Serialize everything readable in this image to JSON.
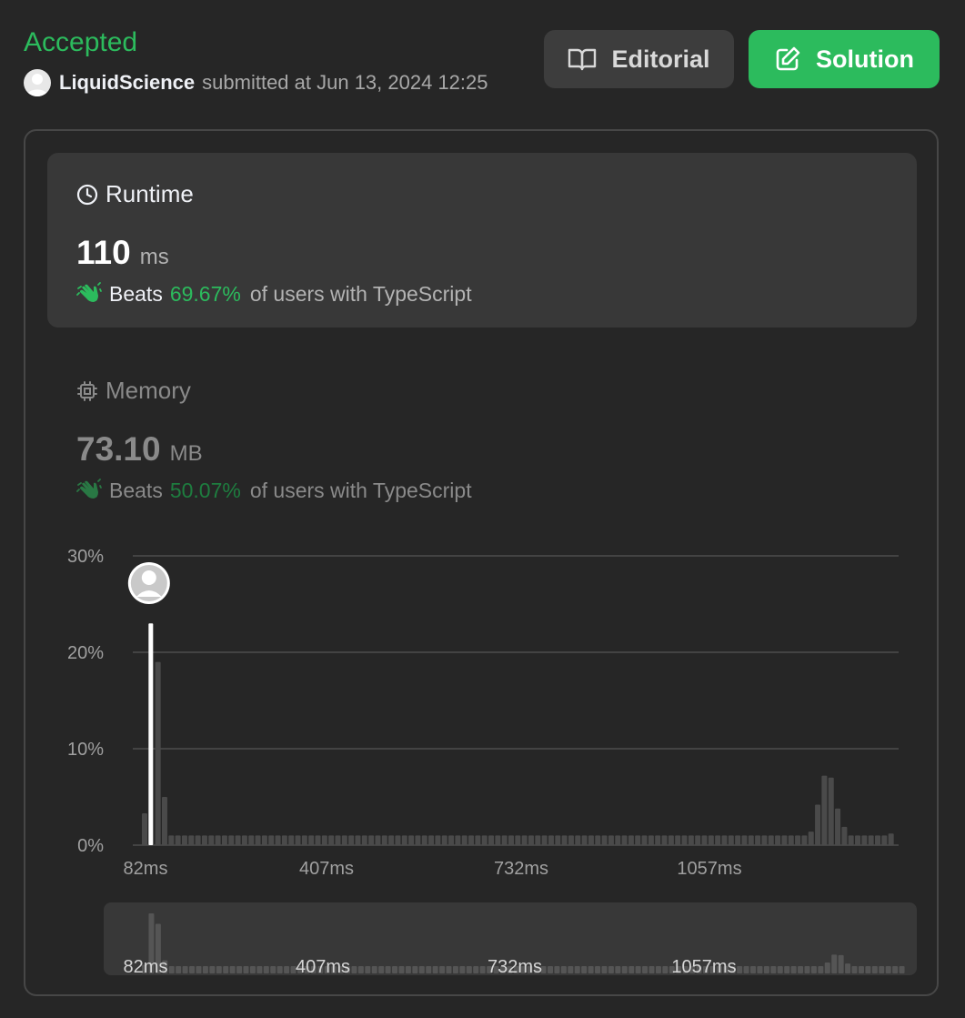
{
  "header": {
    "status": "Accepted",
    "username": "LiquidScience",
    "submitted_text": "submitted at Jun 13, 2024 12:25"
  },
  "buttons": {
    "editorial": "Editorial",
    "solution": "Solution"
  },
  "runtime": {
    "title": "Runtime",
    "value": "110",
    "unit": "ms",
    "beats_label": "Beats",
    "beats_percent": "69.67%",
    "beats_suffix": "of users with TypeScript"
  },
  "memory": {
    "title": "Memory",
    "value": "73.10",
    "unit": "MB",
    "beats_label": "Beats",
    "beats_percent": "50.07%",
    "beats_suffix": "of users with TypeScript"
  },
  "icons": {
    "editorial": "book-icon",
    "solution": "edit-icon",
    "runtime": "clock-icon",
    "memory": "chip-icon",
    "beats": "clapping-hands-icon"
  },
  "colors": {
    "accepted": "#2cbb5d",
    "solution_button": "#2cbb5d",
    "beats_percent": "#2cbb5d",
    "bar": "#4a4a4a",
    "user_bar": "#ffffff"
  },
  "chart_data": {
    "type": "bar",
    "x_ticks": [
      "82ms",
      "407ms",
      "732ms",
      "1057ms"
    ],
    "y_ticks": [
      "0%",
      "10%",
      "20%",
      "30%"
    ],
    "ylim": [
      0,
      30
    ],
    "grid": true,
    "values": [
      3.3,
      23,
      19,
      5,
      1,
      1,
      1,
      1,
      1,
      1,
      1,
      1,
      1,
      1,
      1,
      1,
      1,
      1,
      1,
      1,
      1,
      1,
      1,
      1,
      1,
      1,
      1,
      1,
      1,
      1,
      1,
      1,
      1,
      1,
      1,
      1,
      1,
      1,
      1,
      1,
      1,
      1,
      1,
      1,
      1,
      1,
      1,
      1,
      1,
      1,
      1,
      1,
      1,
      1,
      1,
      1,
      1,
      1,
      1,
      1,
      1,
      1,
      1,
      1,
      1,
      1,
      1,
      1,
      1,
      1,
      1,
      1,
      1,
      1,
      1,
      1,
      1,
      1,
      1,
      1,
      1,
      1,
      1,
      1,
      1,
      1,
      1,
      1,
      1,
      1,
      1,
      1,
      1,
      1,
      1,
      1,
      1,
      1,
      1,
      1,
      1.4,
      4.2,
      7.2,
      7,
      3.8,
      1.9,
      1,
      1,
      1,
      1,
      1,
      1,
      1.2
    ],
    "user_index": 1,
    "mini_x_ticks": [
      "82ms",
      "407ms",
      "732ms",
      "1057ms"
    ]
  }
}
